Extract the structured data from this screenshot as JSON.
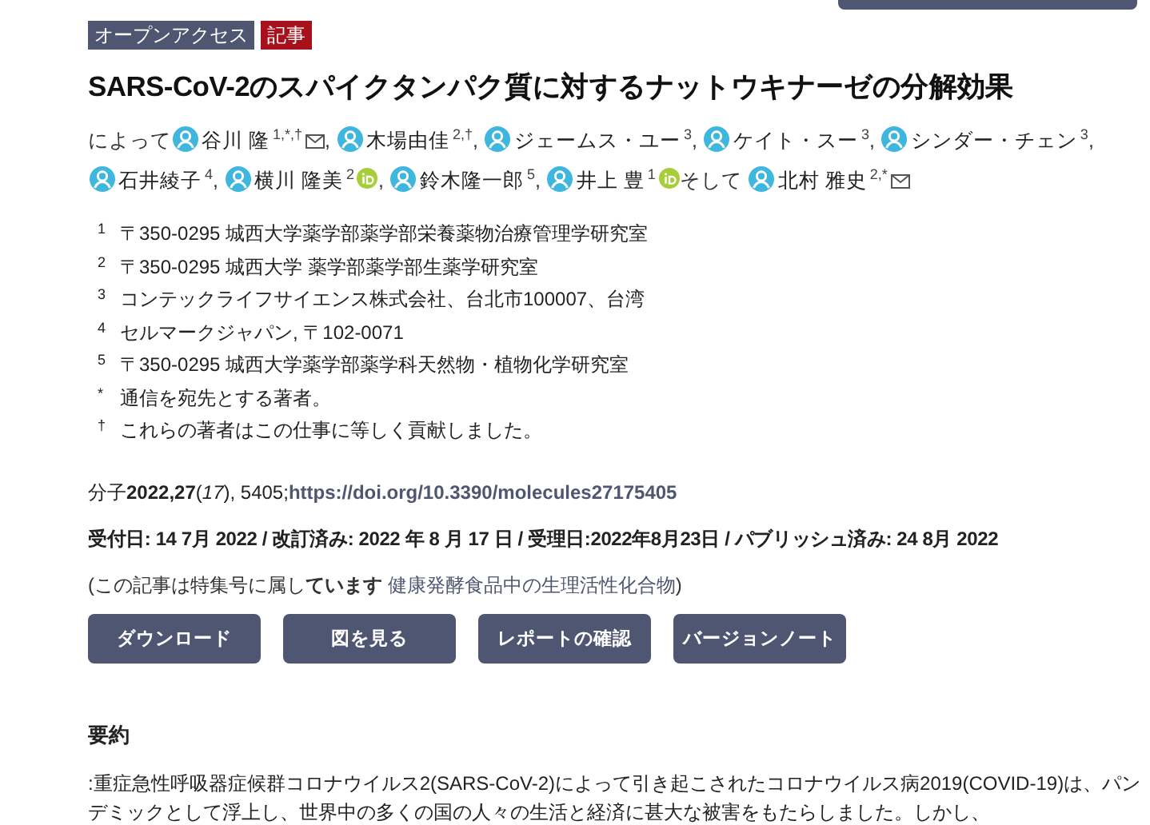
{
  "badges": [
    {
      "label": "オープンアクセス",
      "kind": "access"
    },
    {
      "label": "記事",
      "kind": "type"
    }
  ],
  "title": "SARS-CoV-2のスパイクタンパク質に対するナットウキナーゼの分解効果",
  "authors_intro": "によって",
  "authors": [
    {
      "name": "谷川 隆",
      "sup": "1,*,†",
      "email": true,
      "orcid": false,
      "separator": ","
    },
    {
      "name": "木場由佳",
      "sup": "2,†",
      "email": false,
      "orcid": false,
      "separator": ","
    },
    {
      "name": "ジェームス・ユー",
      "sup": "3",
      "email": false,
      "orcid": false,
      "separator": ","
    },
    {
      "name": "ケイト・スー",
      "sup": "3",
      "email": false,
      "orcid": false,
      "separator": ","
    },
    {
      "name": "シンダー・チェン",
      "sup": "3",
      "email": false,
      "orcid": false,
      "separator": ","
    },
    {
      "name": "石井綾子",
      "sup": "4",
      "email": false,
      "orcid": false,
      "separator": ","
    },
    {
      "name": "横川 隆美",
      "sup": "2",
      "email": false,
      "orcid": true,
      "separator": ","
    },
    {
      "name": "鈴木隆一郎",
      "sup": "5",
      "email": false,
      "orcid": false,
      "separator": ","
    },
    {
      "name": "井上 豊",
      "sup": "1",
      "email": false,
      "orcid": true,
      "separator": "そして"
    },
    {
      "name": "北村 雅史",
      "sup": "2,*",
      "email": true,
      "orcid": false
    }
  ],
  "affiliations": [
    {
      "mark": "1",
      "text": "〒350-0295 城西大学薬学部薬学部栄養薬物治療管理学研究室"
    },
    {
      "mark": "2",
      "text": "〒350-0295 城西大学 薬学部薬学部生薬学研究室"
    },
    {
      "mark": "3",
      "text": "コンテックライフサイエンス株式会社、台北市100007、台湾"
    },
    {
      "mark": "4",
      "text": "セルマークジャパン, 〒102-0071"
    },
    {
      "mark": "5",
      "text": "〒350-0295 城西大学薬学部薬学科天然物・植物化学研究室"
    },
    {
      "mark": "*",
      "text": "通信を宛先とする著者。"
    },
    {
      "mark": "†",
      "text": "これらの著者はこの仕事に等しく貢献しました。"
    }
  ],
  "citation": {
    "text": "分子**2022,27**(*17*), 5405;",
    "doi": "https://doi.org/10.3390/molecules27175405"
  },
  "dates": "受付日: 14 7月 2022 / 改訂済み: 2022 年 8 月 17 日 / 受理日:2022年8月23日 / パブリッシュ済み: 24 8月 2022",
  "special_issue": {
    "prefix": "(この記事は特集号に属し**ています**",
    "link": "健康発酵食品中の生理活性化合物",
    "suffix": ")"
  },
  "buttons": [
    "ダウンロード",
    "図を見る",
    "レポートの確認",
    "バージョンノート"
  ],
  "abstract": {
    "heading": "要約",
    "text": ":重症急性呼吸器症候群コロナウイルス2(SARS-CoV-2)によって引き起こされたコロナウイルス病2019(COVID-19)は、パンデミックとして浮上し、世界中の多くの国の人々の生活と経済に甚大な被害をもたらしました。しかし、"
  }
}
